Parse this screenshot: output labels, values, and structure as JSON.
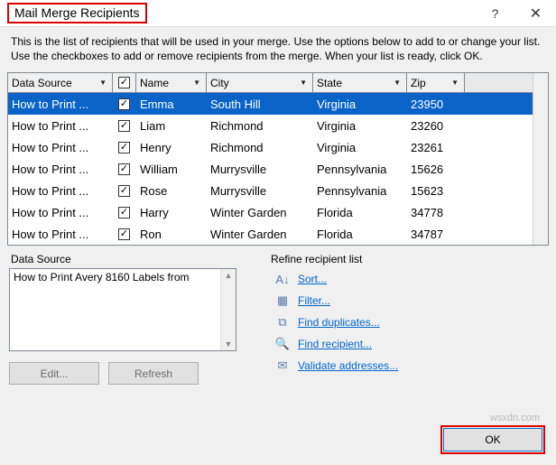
{
  "title": "Mail Merge Recipients",
  "instructions": "This is the list of recipients that will be used in your merge.  Use the options below to add to or change your list.  Use the checkboxes to add or remove recipients from the merge.  When your list is ready, click OK.",
  "columns": {
    "data_source": "Data Source",
    "name": "Name",
    "city": "City",
    "state": "State",
    "zip": "Zip"
  },
  "rows": [
    {
      "ds": "How to Print ...",
      "name": "Emma",
      "city": "South Hill",
      "state": "Virginia",
      "zip": "23950",
      "selected": true
    },
    {
      "ds": "How to Print ...",
      "name": "Liam",
      "city": "Richmond",
      "state": "Virginia",
      "zip": "23260",
      "selected": false
    },
    {
      "ds": "How to Print ...",
      "name": "Henry",
      "city": "Richmond",
      "state": "Virginia",
      "zip": "23261",
      "selected": false
    },
    {
      "ds": "How to Print ...",
      "name": "William",
      "city": "Murrysville",
      "state": "Pennsylvania",
      "zip": "15626",
      "selected": false
    },
    {
      "ds": "How to Print ...",
      "name": "Rose",
      "city": "Murrysville",
      "state": "Pennsylvania",
      "zip": "15623",
      "selected": false
    },
    {
      "ds": "How to Print ...",
      "name": "Harry",
      "city": "Winter Garden",
      "state": "Florida",
      "zip": "34778",
      "selected": false
    },
    {
      "ds": "How to Print ...",
      "name": "Ron",
      "city": "Winter Garden",
      "state": "Florida",
      "zip": "34787",
      "selected": false
    }
  ],
  "data_source_panel": {
    "label": "Data Source",
    "item": "How to Print Avery 8160 Labels from"
  },
  "buttons": {
    "edit": "Edit...",
    "refresh": "Refresh",
    "ok": "OK"
  },
  "refine": {
    "label": "Refine recipient list",
    "sort": "Sort...",
    "filter": "Filter...",
    "duplicates": "Find duplicates...",
    "recipient": "Find recipient...",
    "validate": "Validate addresses..."
  },
  "watermark": "wsxdn.com"
}
